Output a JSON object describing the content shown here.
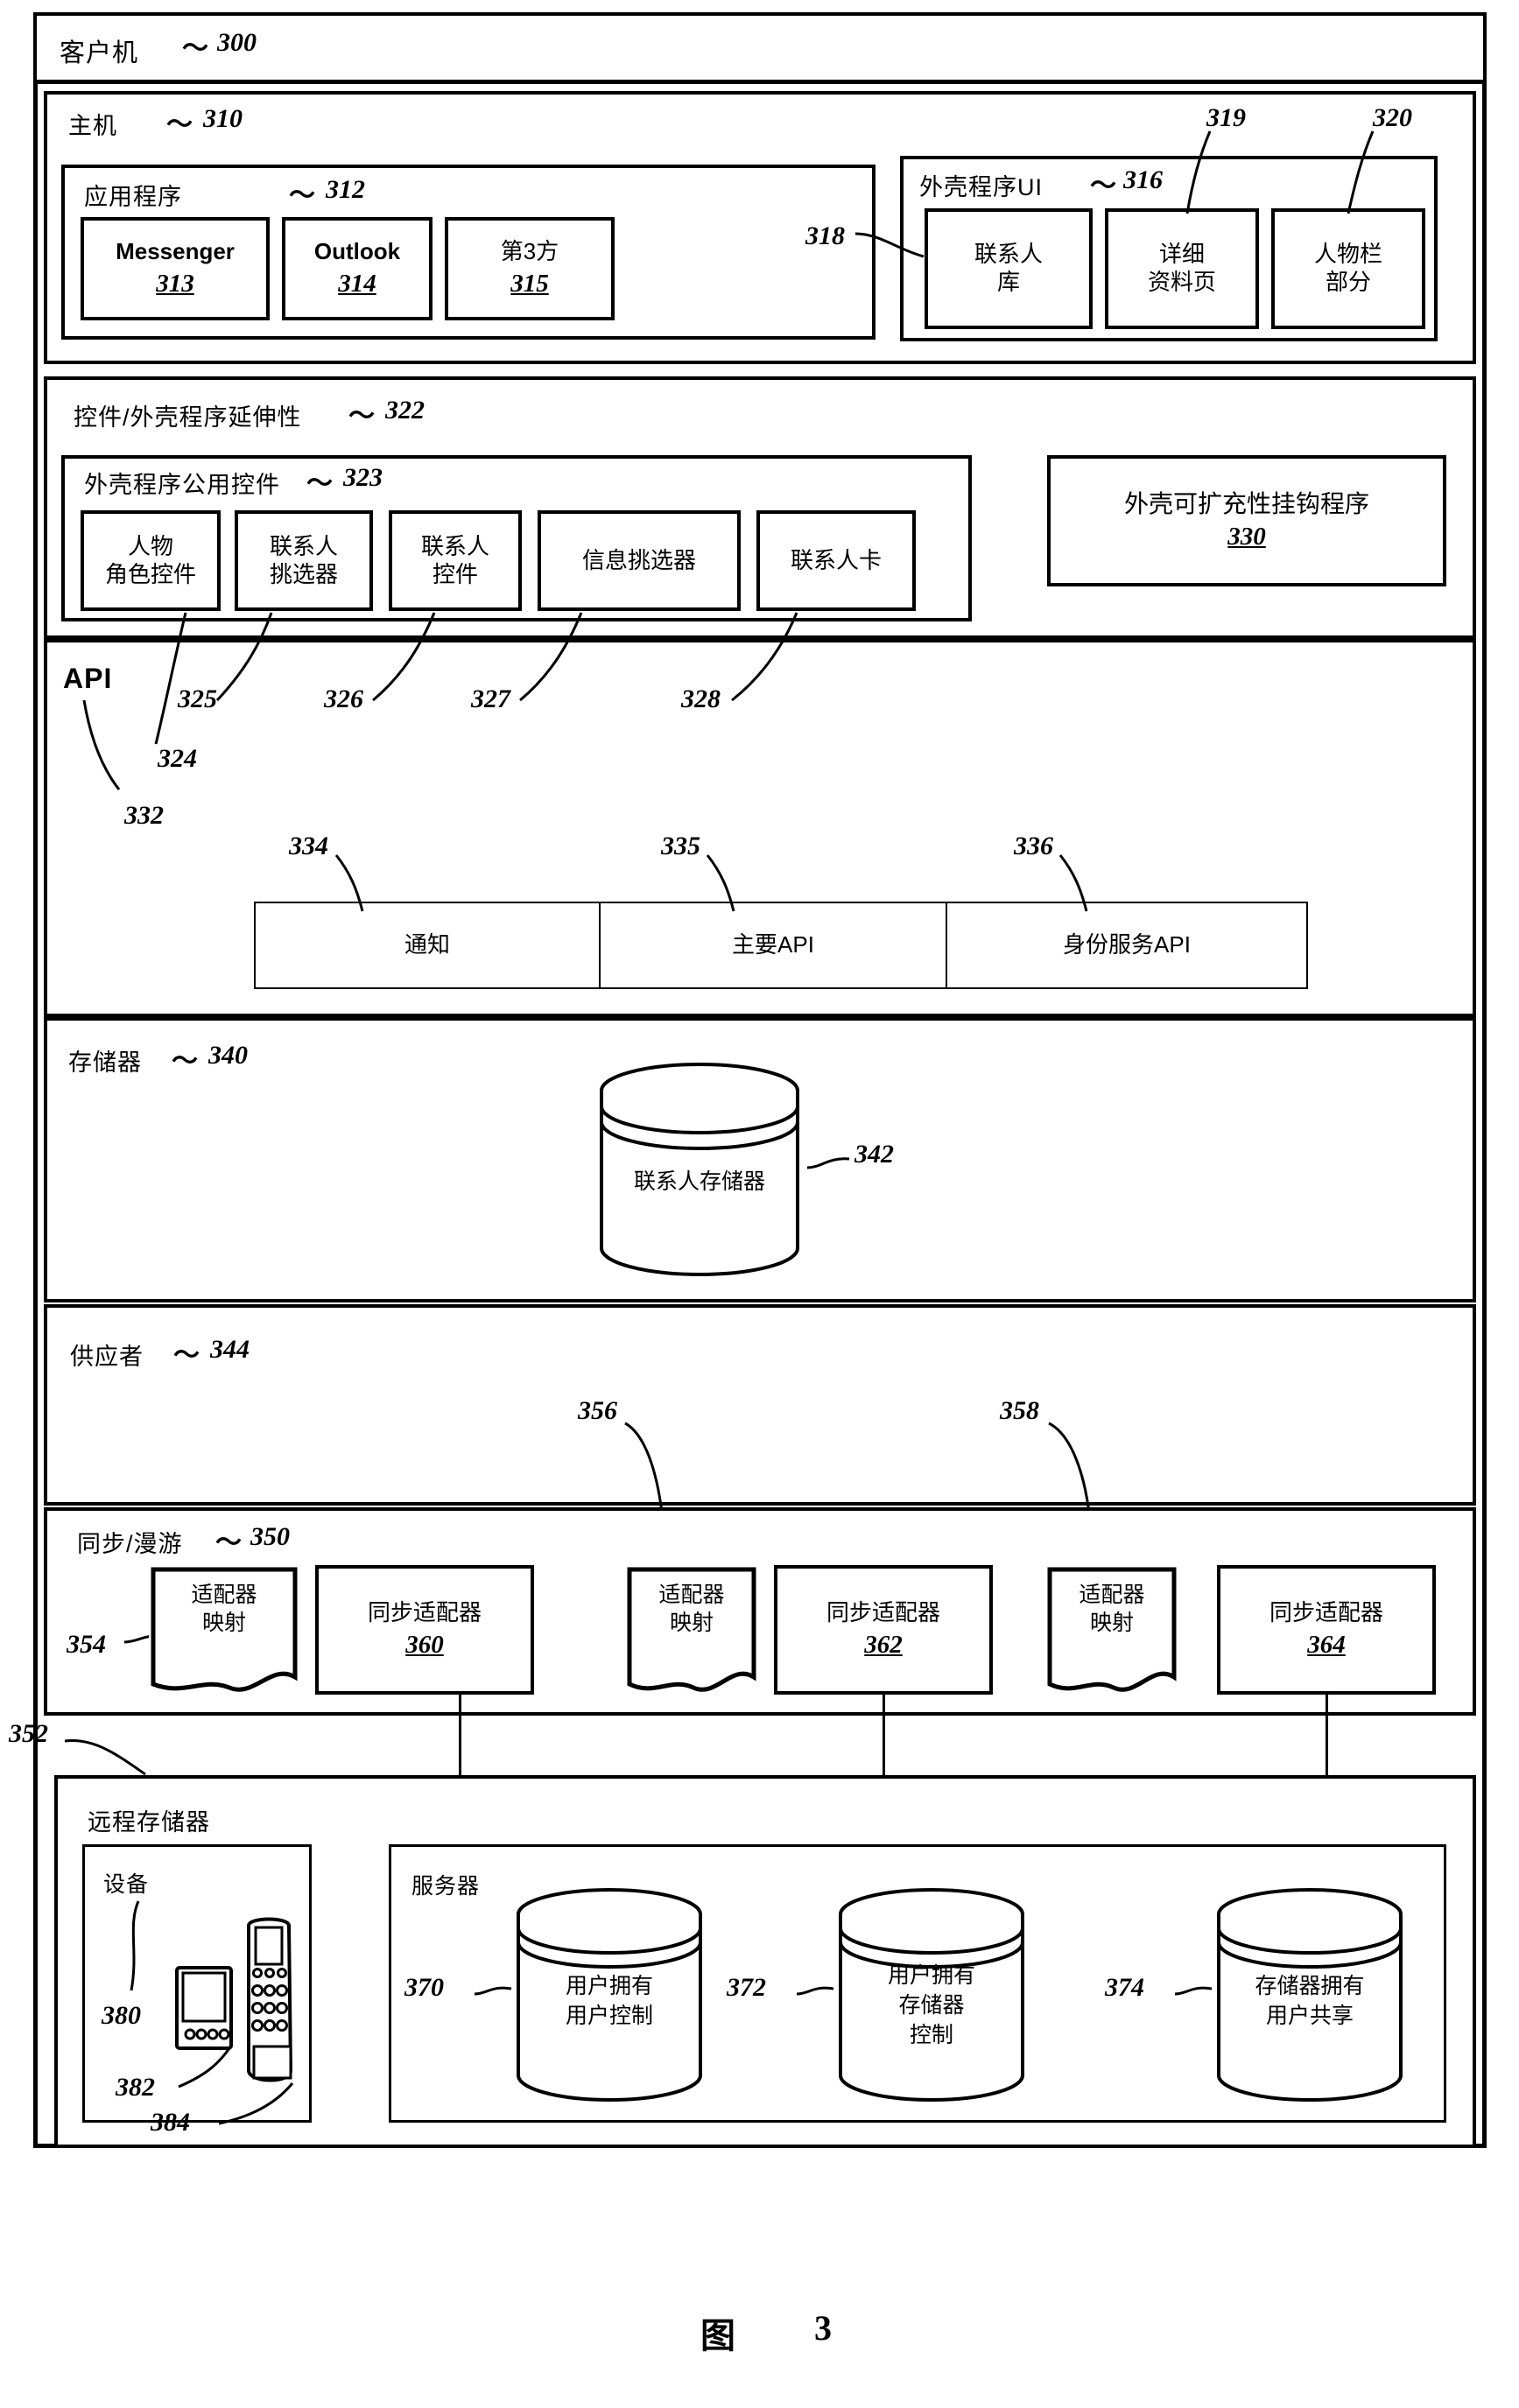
{
  "figure": {
    "label": "图",
    "number": "3"
  },
  "client": {
    "label": "客户机",
    "ref": "300"
  },
  "host": {
    "label": "主机",
    "ref": "310"
  },
  "applications": {
    "label": "应用程序",
    "ref": "312",
    "items": [
      {
        "label": "Messenger",
        "ref": "313"
      },
      {
        "label": "Outlook",
        "ref": "314"
      },
      {
        "label": "第3方",
        "ref": "315"
      }
    ]
  },
  "shell_ui": {
    "label": "外壳程序UI",
    "ref": "316",
    "callouts": {
      "left": "318",
      "mid": "319",
      "right": "320"
    },
    "items": [
      {
        "line1": "联系人",
        "line2": "库"
      },
      {
        "line1": "详细",
        "line2": "资料页"
      },
      {
        "line1": "人物栏",
        "line2": "部分"
      }
    ]
  },
  "controls_section": {
    "label": "控件/外壳程序延伸性",
    "ref": "322"
  },
  "common_controls": {
    "label": "外壳程序公用控件",
    "ref": "323",
    "items": [
      {
        "line1": "人物",
        "line2": "角色控件",
        "ref": "324"
      },
      {
        "line1": "联系人",
        "line2": "挑选器",
        "ref": "325"
      },
      {
        "line1": "联系人",
        "line2": "控件",
        "ref": "326"
      },
      {
        "line1": "信息挑选器",
        "line2": "",
        "ref": "327"
      },
      {
        "line1": "联系人卡",
        "line2": "",
        "ref": "328"
      }
    ]
  },
  "hook_program": {
    "label": "外壳可扩充性挂钩程序",
    "ref": "330"
  },
  "api_section": {
    "label": "API",
    "ref": "332",
    "items": [
      {
        "label": "通知",
        "ref": "334"
      },
      {
        "label": "主要API",
        "ref": "335"
      },
      {
        "label": "身份服务API",
        "ref": "336"
      }
    ]
  },
  "storage_section": {
    "label": "存储器",
    "ref": "340",
    "store": {
      "label": "联系人存储器",
      "ref": "342"
    }
  },
  "provider_section": {
    "label": "供应者",
    "ref": "344"
  },
  "sync_section": {
    "label": "同步/漫游",
    "ref": "350",
    "map_ref": "354",
    "callouts": {
      "a": "356",
      "b": "358"
    },
    "items": [
      {
        "type": "map",
        "line1": "适配器",
        "line2": "映射"
      },
      {
        "type": "adapter",
        "label": "同步适配器",
        "ref": "360"
      },
      {
        "type": "map",
        "line1": "适配器",
        "line2": "映射"
      },
      {
        "type": "adapter",
        "label": "同步适配器",
        "ref": "362"
      },
      {
        "type": "map",
        "line1": "适配器",
        "line2": "映射"
      },
      {
        "type": "adapter",
        "label": "同步适配器",
        "ref": "364"
      }
    ]
  },
  "remote_storage": {
    "label": "远程存储器",
    "ref": "352",
    "devices": {
      "label": "设备",
      "ref": "380",
      "pda_ref": "382",
      "phone_ref": "384"
    },
    "server": {
      "label": "服务器",
      "stores": [
        {
          "line1": "用户拥有",
          "line2": "用户控制",
          "ref": "370"
        },
        {
          "line1": "用户拥有",
          "line2": "存储器",
          "line3": "控制",
          "ref": "372"
        },
        {
          "line1": "存储器拥有",
          "line2": "用户共享",
          "ref": "374"
        }
      ]
    }
  }
}
